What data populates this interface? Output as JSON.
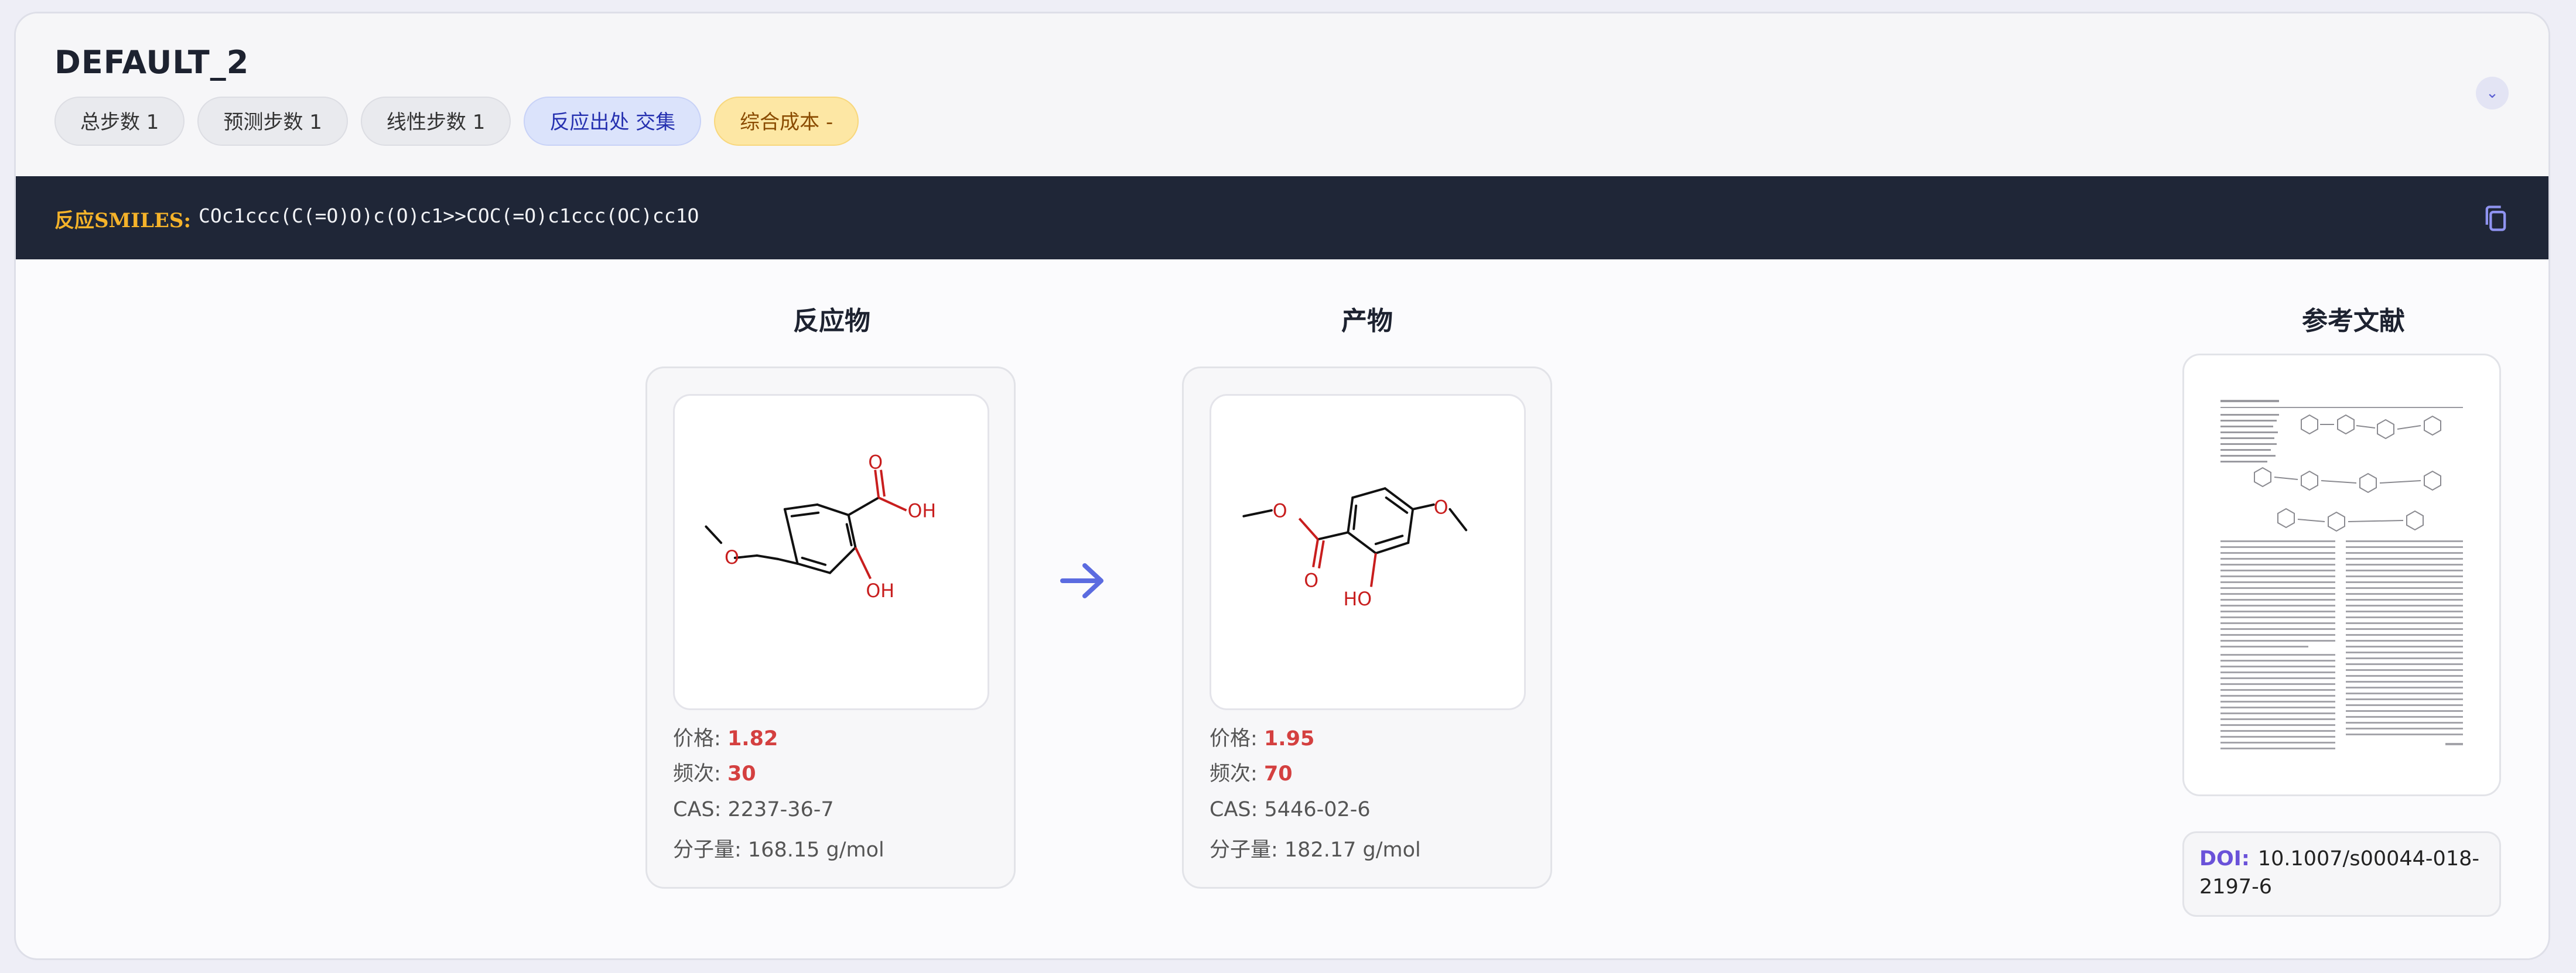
{
  "route": {
    "title": "DEFAULT_2",
    "chips": [
      {
        "label": "总步数 1"
      },
      {
        "label": "预测步数 1"
      },
      {
        "label": "线性步数 1"
      },
      {
        "label": "反应出处 交集"
      },
      {
        "label": "综合成本 -"
      }
    ]
  },
  "smiles": {
    "label": "反应SMILES:",
    "value": "COc1ccc(C(=O)O)c(O)c1>>COC(=O)c1ccc(OC)cc1O"
  },
  "sections": {
    "reactant": "反应物",
    "product": "产物",
    "reference": "参考文献"
  },
  "reactant": {
    "price_label": "价格:",
    "price": "1.82",
    "freq_label": "频次:",
    "freq": "30",
    "cas": "CAS: 2237-36-7",
    "mw": "分子量: 168.15 g/mol",
    "atoms": {
      "o_methoxy": "O",
      "o_carbonyl": "O",
      "oh_acid": "OH",
      "oh_phenol": "OH"
    }
  },
  "product": {
    "price_label": "价格:",
    "price": "1.95",
    "freq_label": "频次:",
    "freq": "70",
    "cas": "CAS: 5446-02-6",
    "mw": "分子量: 182.17 g/mol",
    "atoms": {
      "o_ester": "O",
      "o_carbonyl": "O",
      "oh_phenol": "HO",
      "o_methoxy": "O"
    }
  },
  "reference": {
    "doi_label": "DOI:",
    "doi": "10.1007/s00044-018-2197-6"
  },
  "colors": {
    "accent": "#5b5fd3",
    "price": "#d44040",
    "smiles_bg": "#1f2637",
    "smiles_label": "#f5b32a"
  }
}
